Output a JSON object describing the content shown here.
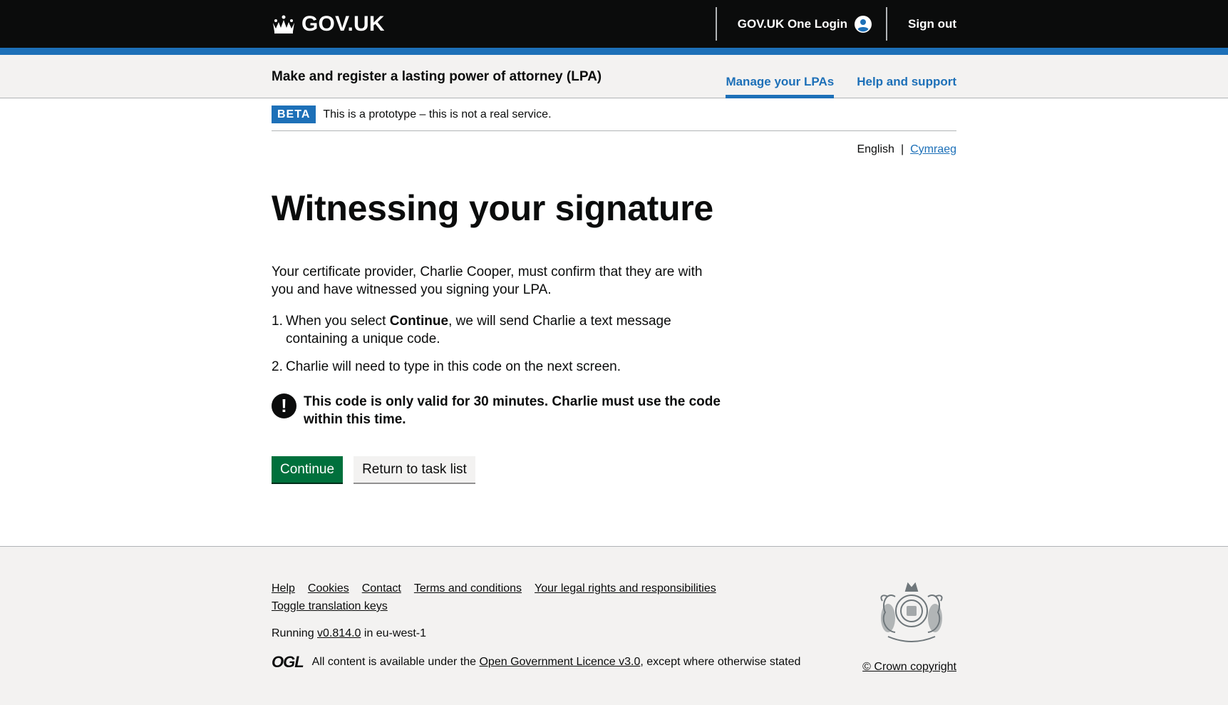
{
  "header": {
    "logo_text": "GOV.UK",
    "one_login_label": "GOV.UK One Login",
    "sign_out_label": "Sign out"
  },
  "service_nav": {
    "service_name": "Make and register a lasting power of attorney (LPA)",
    "items": [
      {
        "label": "Manage your LPAs",
        "active": true
      },
      {
        "label": "Help and support",
        "active": false
      }
    ]
  },
  "phase_banner": {
    "tag": "BETA",
    "text": "This is a prototype – this is not a real service."
  },
  "language": {
    "current": "English",
    "separator": "|",
    "alternate": "Cymraeg"
  },
  "main": {
    "title": "Witnessing your signature",
    "intro": "Your certificate provider, Charlie Cooper, must confirm that they are with you and have witnessed you signing your LPA.",
    "steps": [
      {
        "num": "1.",
        "prefix": "When you select ",
        "bold": "Continue",
        "suffix": ", we will send Charlie a text message containing a unique code."
      },
      {
        "num": "2.",
        "text": "Charlie will need to type in this code on the next screen."
      }
    ],
    "warning_icon": "!",
    "warning": "This code is only valid for 30 minutes. Charlie must use the code within this time.",
    "continue_label": "Continue",
    "return_label": "Return to task list"
  },
  "footer": {
    "links": [
      "Help",
      "Cookies",
      "Contact",
      "Terms and conditions",
      "Your legal rights and responsibilities",
      "Toggle translation keys"
    ],
    "running_prefix": "Running ",
    "version": "v0.814.0",
    "running_suffix": " in eu-west-1",
    "ogl_logo": "OGL",
    "licence_prefix": "All content is available under the ",
    "licence_link": "Open Government Licence v3.0",
    "licence_suffix": ", except where otherwise stated",
    "copyright": "© Crown copyright"
  },
  "colors": {
    "header_bg": "#0b0c0c",
    "brand_blue": "#1d70b8",
    "primary_green": "#00703c",
    "footer_bg": "#f3f2f1"
  },
  "icons": [
    "crown-icon",
    "user-icon",
    "warning-icon",
    "ogl-logo",
    "royal-crest"
  ]
}
